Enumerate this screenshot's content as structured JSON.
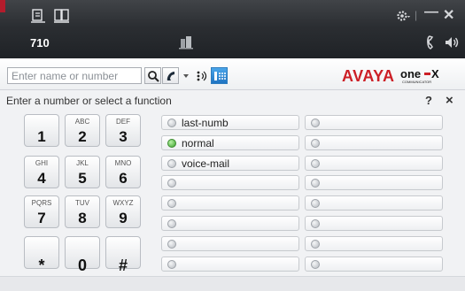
{
  "titlebar": {
    "extension": "710",
    "icons": [
      "contacts-icon",
      "directory-icon",
      "gear-icon",
      "minimize-icon",
      "close-icon",
      "phone-handset-icon",
      "speaker-icon",
      "buildings-icon"
    ]
  },
  "search": {
    "placeholder": "Enter name or number"
  },
  "brand": {
    "avaya": "AVAYA",
    "product": "one-X Communicator"
  },
  "dialpad": {
    "prompt": "Enter a number or select a function",
    "help_label": "?",
    "close_label": "×",
    "keys": [
      {
        "digit": "1",
        "letters": ""
      },
      {
        "digit": "2",
        "letters": "ABC"
      },
      {
        "digit": "3",
        "letters": "DEF"
      },
      {
        "digit": "4",
        "letters": "GHI"
      },
      {
        "digit": "5",
        "letters": "JKL"
      },
      {
        "digit": "6",
        "letters": "MNO"
      },
      {
        "digit": "7",
        "letters": "PQRS"
      },
      {
        "digit": "8",
        "letters": "TUV"
      },
      {
        "digit": "9",
        "letters": "WXYZ"
      },
      {
        "digit": "*",
        "letters": ""
      },
      {
        "digit": "0",
        "letters": ""
      },
      {
        "digit": "#",
        "letters": ""
      }
    ]
  },
  "functions": {
    "left": [
      {
        "label": "last-numb",
        "active": false
      },
      {
        "label": "normal",
        "active": true
      },
      {
        "label": "voice-mail",
        "active": false
      },
      {
        "label": "",
        "active": false
      },
      {
        "label": "",
        "active": false
      },
      {
        "label": "",
        "active": false
      },
      {
        "label": "",
        "active": false
      },
      {
        "label": "",
        "active": false
      }
    ],
    "right": [
      {
        "label": "",
        "active": false
      },
      {
        "label": "",
        "active": false
      },
      {
        "label": "",
        "active": false
      },
      {
        "label": "",
        "active": false
      },
      {
        "label": "",
        "active": false
      },
      {
        "label": "",
        "active": false
      },
      {
        "label": "",
        "active": false
      },
      {
        "label": "",
        "active": false
      }
    ]
  },
  "colors": {
    "brand_red": "#cc1f26",
    "active_led": "#3aa12a",
    "titlebar": "#2b2e32"
  }
}
